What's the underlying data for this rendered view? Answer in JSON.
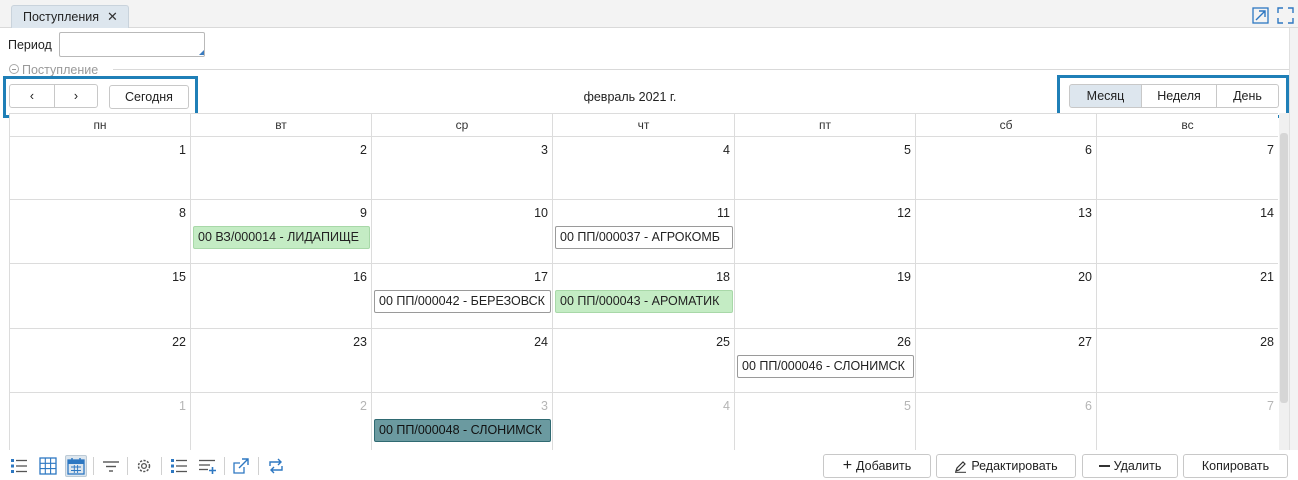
{
  "tab": {
    "title": "Поступления",
    "close_icon": "✕"
  },
  "period": {
    "label": "Период",
    "value": ""
  },
  "group": {
    "label": "Поступление"
  },
  "toolbar": {
    "prev": "‹",
    "next": "›",
    "today": "Сегодня",
    "title": "февраль 2021 г.",
    "views": [
      "Месяц",
      "Неделя",
      "День"
    ],
    "active_view": "Месяц"
  },
  "calendar": {
    "weekdays": [
      "пн",
      "вт",
      "ср",
      "чт",
      "пт",
      "сб",
      "вс"
    ],
    "weeks": [
      [
        "1",
        "2",
        "3",
        "4",
        "5",
        "6",
        "7"
      ],
      [
        "8",
        "9",
        "10",
        "11",
        "12",
        "13",
        "14"
      ],
      [
        "15",
        "16",
        "17",
        "18",
        "19",
        "20",
        "21"
      ],
      [
        "22",
        "23",
        "24",
        "25",
        "26",
        "27",
        "28"
      ],
      [
        "1",
        "2",
        "3",
        "4",
        "5",
        "6",
        "7"
      ]
    ],
    "events": [
      {
        "week": 1,
        "day": 1,
        "text": "00  ВЗ/000014 - ЛИДАПИЩЕ",
        "style": "green"
      },
      {
        "week": 1,
        "day": 3,
        "text": "00  ПП/000037 - АГРОКОМБ",
        "style": "white"
      },
      {
        "week": 2,
        "day": 2,
        "text": "00  ПП/000042 - БЕРЕЗОВСК",
        "style": "white"
      },
      {
        "week": 2,
        "day": 3,
        "text": "00  ПП/000043 - АРОМАТИК",
        "style": "green"
      },
      {
        "week": 3,
        "day": 4,
        "text": "00  ПП/000046 - СЛОНИМСК",
        "style": "white"
      },
      {
        "week": 4,
        "day": 2,
        "text": "00  ПП/000048 - СЛОНИМСК",
        "style": "teal"
      }
    ]
  },
  "actions": {
    "add": "Добавить",
    "edit": "Редактировать",
    "delete": "Удалить",
    "copy": "Копировать"
  },
  "colors": {
    "highlight": "#1f7fb7",
    "event_green": "#c4ecc4",
    "event_teal": "#6b9aa0",
    "active_bg": "#dde6ee",
    "icon_blue": "#2e78c2"
  }
}
